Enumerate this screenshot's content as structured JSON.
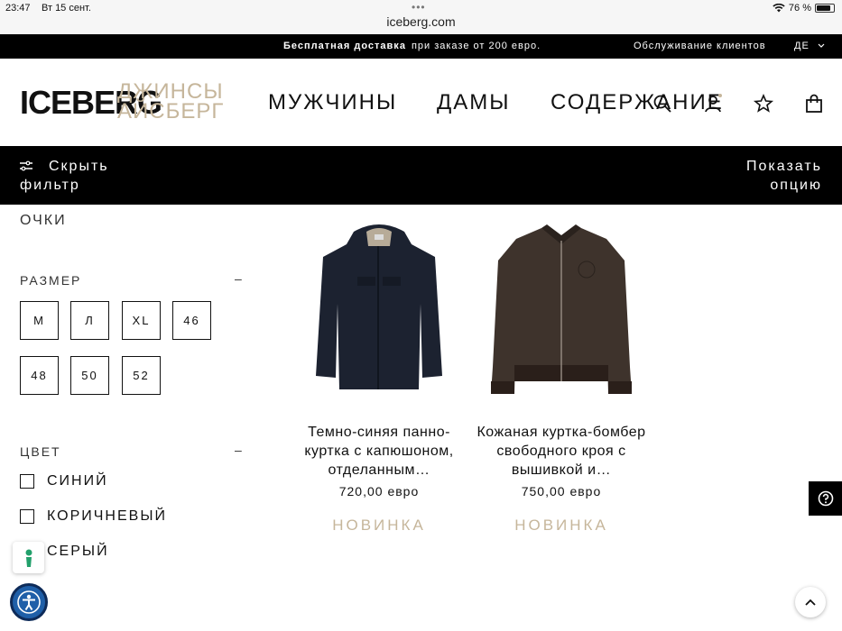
{
  "status_bar": {
    "time": "23:47",
    "date": "Вт 15 сент.",
    "url": "iceberg.com",
    "battery": "76 %"
  },
  "promo_bar": {
    "bold": "Бесплатная доставка",
    "text": "при заказе от 200 евро.",
    "service": "Обслуживание клиентов",
    "lang": "ДЕ"
  },
  "header": {
    "logo": "ICEBERG",
    "logo_sub_1": "ДЖИНСЫ",
    "logo_sub_2": "АЙСБЕРГ",
    "nav": [
      "МУЖЧИНЫ",
      "ДАМЫ",
      "СОДЕРЖАНИЕ"
    ]
  },
  "filter_bar": {
    "hide_1": "Скрыть",
    "hide_2": "фильтр",
    "show_1": "Показать",
    "show_2": "опцию"
  },
  "sidebar": {
    "glasses": "ОЧКИ",
    "size_title": "РАЗМЕР",
    "sizes": [
      "М",
      "Л",
      "XL",
      "46",
      "48",
      "50",
      "52"
    ],
    "color_title": "ЦВЕТ",
    "colors": [
      "СИНИЙ",
      "КОРИЧНЕВЫЙ",
      "СЕРЫЙ"
    ],
    "collapse": "–"
  },
  "products": [
    {
      "title": "Темно-синяя панно-куртка с капюшоном, отделанным…",
      "price": "720,00 евро",
      "badge": "НОВИНКА",
      "color": "#1c2230"
    },
    {
      "title": "Кожаная куртка-бомбер свободного кроя с вышивкой и…",
      "price": "750,00 евро",
      "badge": "НОВИНКА",
      "color": "#3e332c"
    }
  ],
  "icons": {
    "search": "search-icon",
    "user": "user-icon",
    "wishlist": "star-icon",
    "cart": "bag-icon",
    "filter": "sliders-icon"
  },
  "colors": {
    "accent_beige": "#c6b69b",
    "black": "#000000"
  }
}
